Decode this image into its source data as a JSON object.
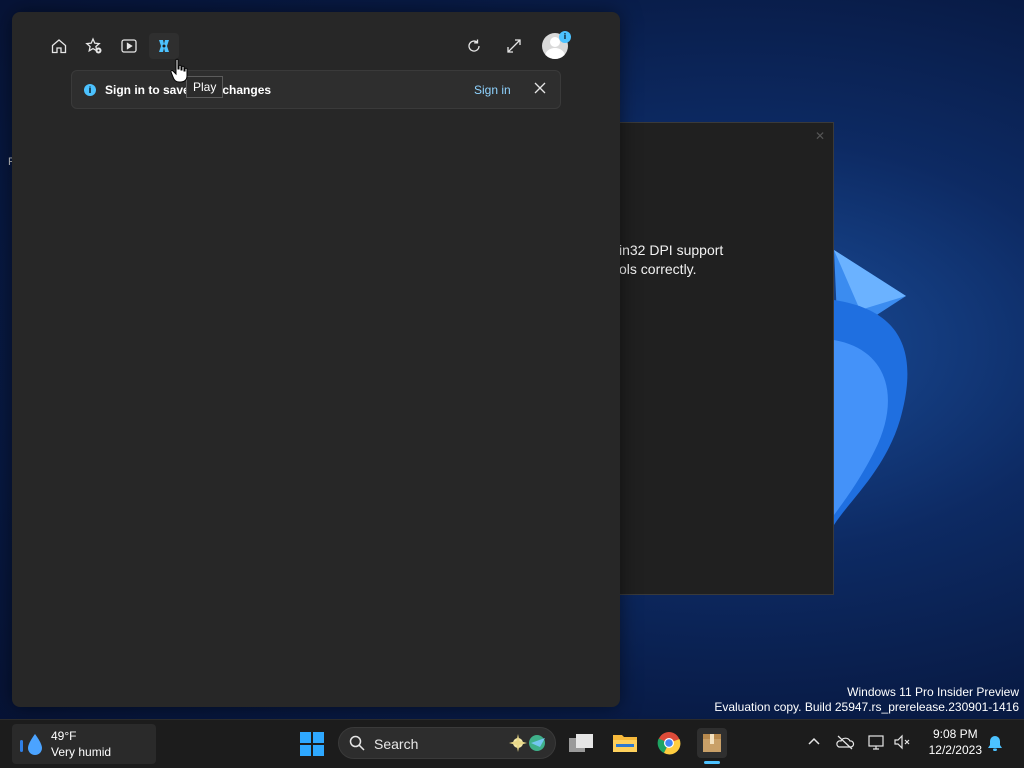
{
  "background_window": {
    "text": "in32 DPI support\nols correctly."
  },
  "desktop_glyph": "F",
  "flyout": {
    "nav": {
      "home": "home-icon",
      "favorites": "star-settings-icon",
      "video": "play-video-icon",
      "play": "game-icon"
    },
    "tooltip": "Play",
    "banner": {
      "message": "Sign in to save your changes",
      "action": "Sign in"
    },
    "avatar_badge": "i"
  },
  "watermark": {
    "line1": "Windows 11 Pro Insider Preview",
    "line2": "Evaluation copy. Build 25947.rs_prerelease.230901-1416"
  },
  "taskbar": {
    "weather": {
      "temp": "49°F",
      "condition": "Very humid"
    },
    "search_label": "Search",
    "clock": {
      "time": "9:08 PM",
      "date": "12/2/2023"
    }
  },
  "colors": {
    "accent": "#4cc2ff",
    "flyout_bg": "#272727",
    "taskbar_bg": "#1c1c1c"
  }
}
